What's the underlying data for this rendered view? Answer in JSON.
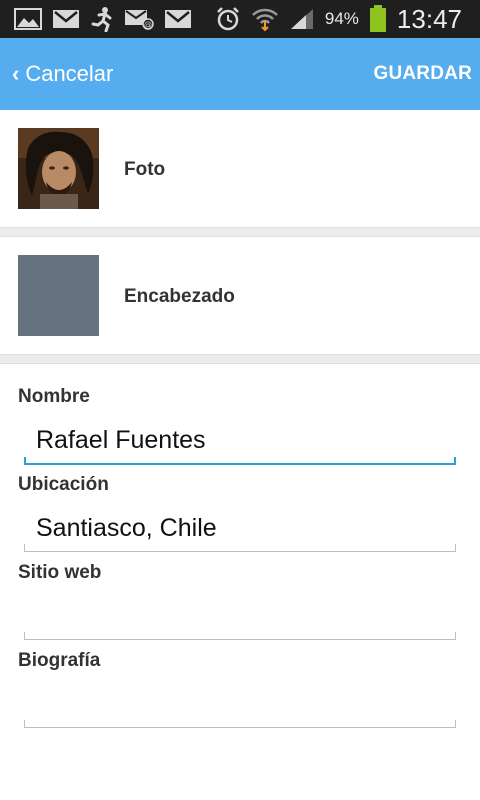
{
  "status_bar": {
    "battery_percent": "94%",
    "time": "13:47",
    "icons": [
      "gallery-icon",
      "gmail-icon",
      "runner-icon",
      "email-at-icon",
      "gmail-icon",
      "alarm-icon",
      "wifi-icon",
      "signal-icon",
      "battery-icon"
    ]
  },
  "action_bar": {
    "back_label": "Cancelar",
    "save_label": "GUARDAR",
    "color": "#55acee"
  },
  "images": {
    "photo_label": "Foto",
    "header_label": "Encabezado",
    "header_color": "#66737f"
  },
  "fields": {
    "name": {
      "label": "Nombre",
      "value": "Rafael Fuentes"
    },
    "location": {
      "label": "Ubicación",
      "value": "Santiasco, Chile"
    },
    "website": {
      "label": "Sitio web",
      "value": ""
    },
    "bio": {
      "label": "Biografía",
      "value": ""
    }
  },
  "accent_color": "#2aa3c4"
}
